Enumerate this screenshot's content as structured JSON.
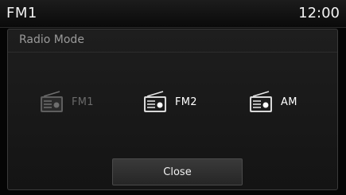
{
  "status_bar": {
    "title": "FM1",
    "clock": "12:00"
  },
  "dialog": {
    "title": "Radio Mode",
    "options": [
      {
        "label": "FM1",
        "icon": "radio-icon",
        "state": "disabled"
      },
      {
        "label": "FM2",
        "icon": "radio-icon",
        "state": "enabled"
      },
      {
        "label": "AM",
        "icon": "radio-icon",
        "state": "enabled"
      }
    ],
    "close_label": "Close"
  },
  "colors": {
    "accent": "#ffffff",
    "disabled_text": "#6a6a6a",
    "background": "#050505"
  }
}
